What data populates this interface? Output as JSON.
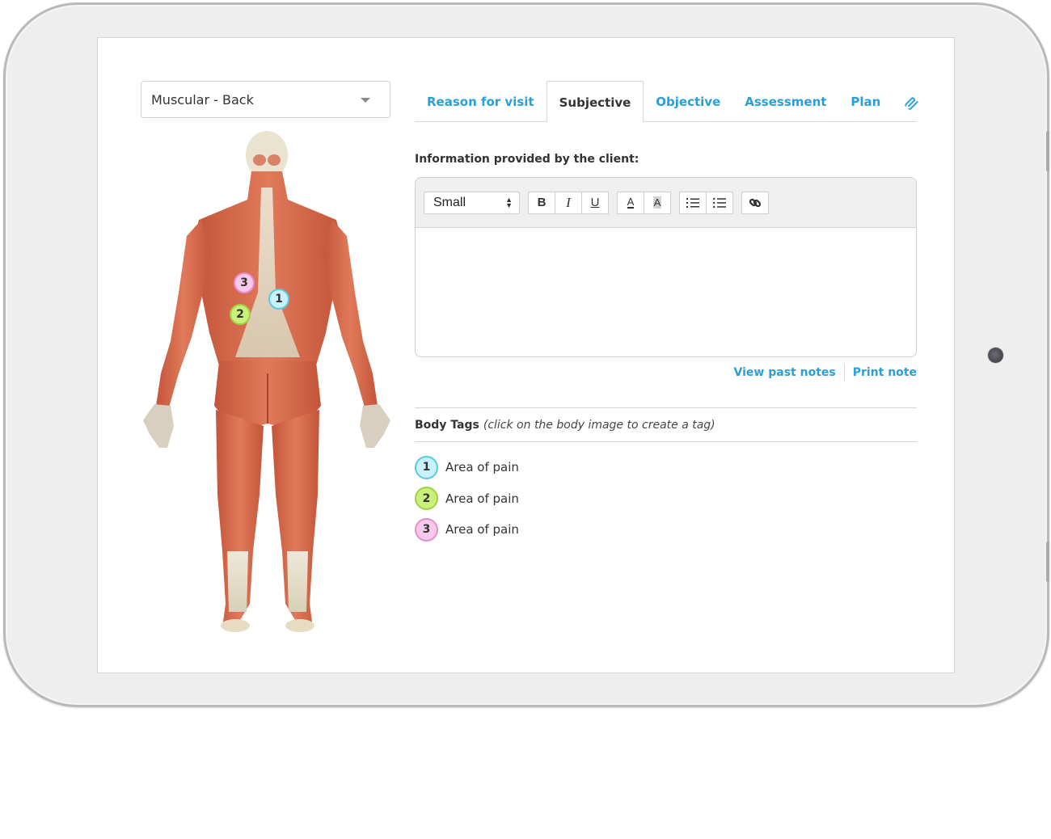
{
  "body_view": {
    "selected": "Muscular - Back"
  },
  "tabs": [
    {
      "label": "Reason for visit",
      "active": false
    },
    {
      "label": "Subjective",
      "active": true
    },
    {
      "label": "Objective",
      "active": false
    },
    {
      "label": "Assessment",
      "active": false
    },
    {
      "label": "Plan",
      "active": false
    },
    {
      "label": "",
      "icon": "paperclip-icon",
      "active": false
    }
  ],
  "subjective": {
    "label": "Information provided by the client:",
    "toolbar": {
      "font_size": "Small",
      "bold": "B",
      "italic": "I",
      "underline": "U",
      "font_color": "A",
      "background_color": "A"
    },
    "content": ""
  },
  "links": {
    "view_past_notes": "View past notes",
    "print_note": "Print note"
  },
  "body_tags": {
    "title": "Body Tags",
    "hint": "(click on the body image to create a tag)",
    "items": [
      {
        "number": "1",
        "label": "Area of pain",
        "color": "#c8f1fb"
      },
      {
        "number": "2",
        "label": "Area of pain",
        "color": "#c9f07a"
      },
      {
        "number": "3",
        "label": "Area of pain",
        "color": "#f9c9ec"
      }
    ]
  },
  "colors": {
    "accent": "#2a9fd6",
    "muscle": "#d9694a",
    "tendon": "#e8e2cf"
  }
}
